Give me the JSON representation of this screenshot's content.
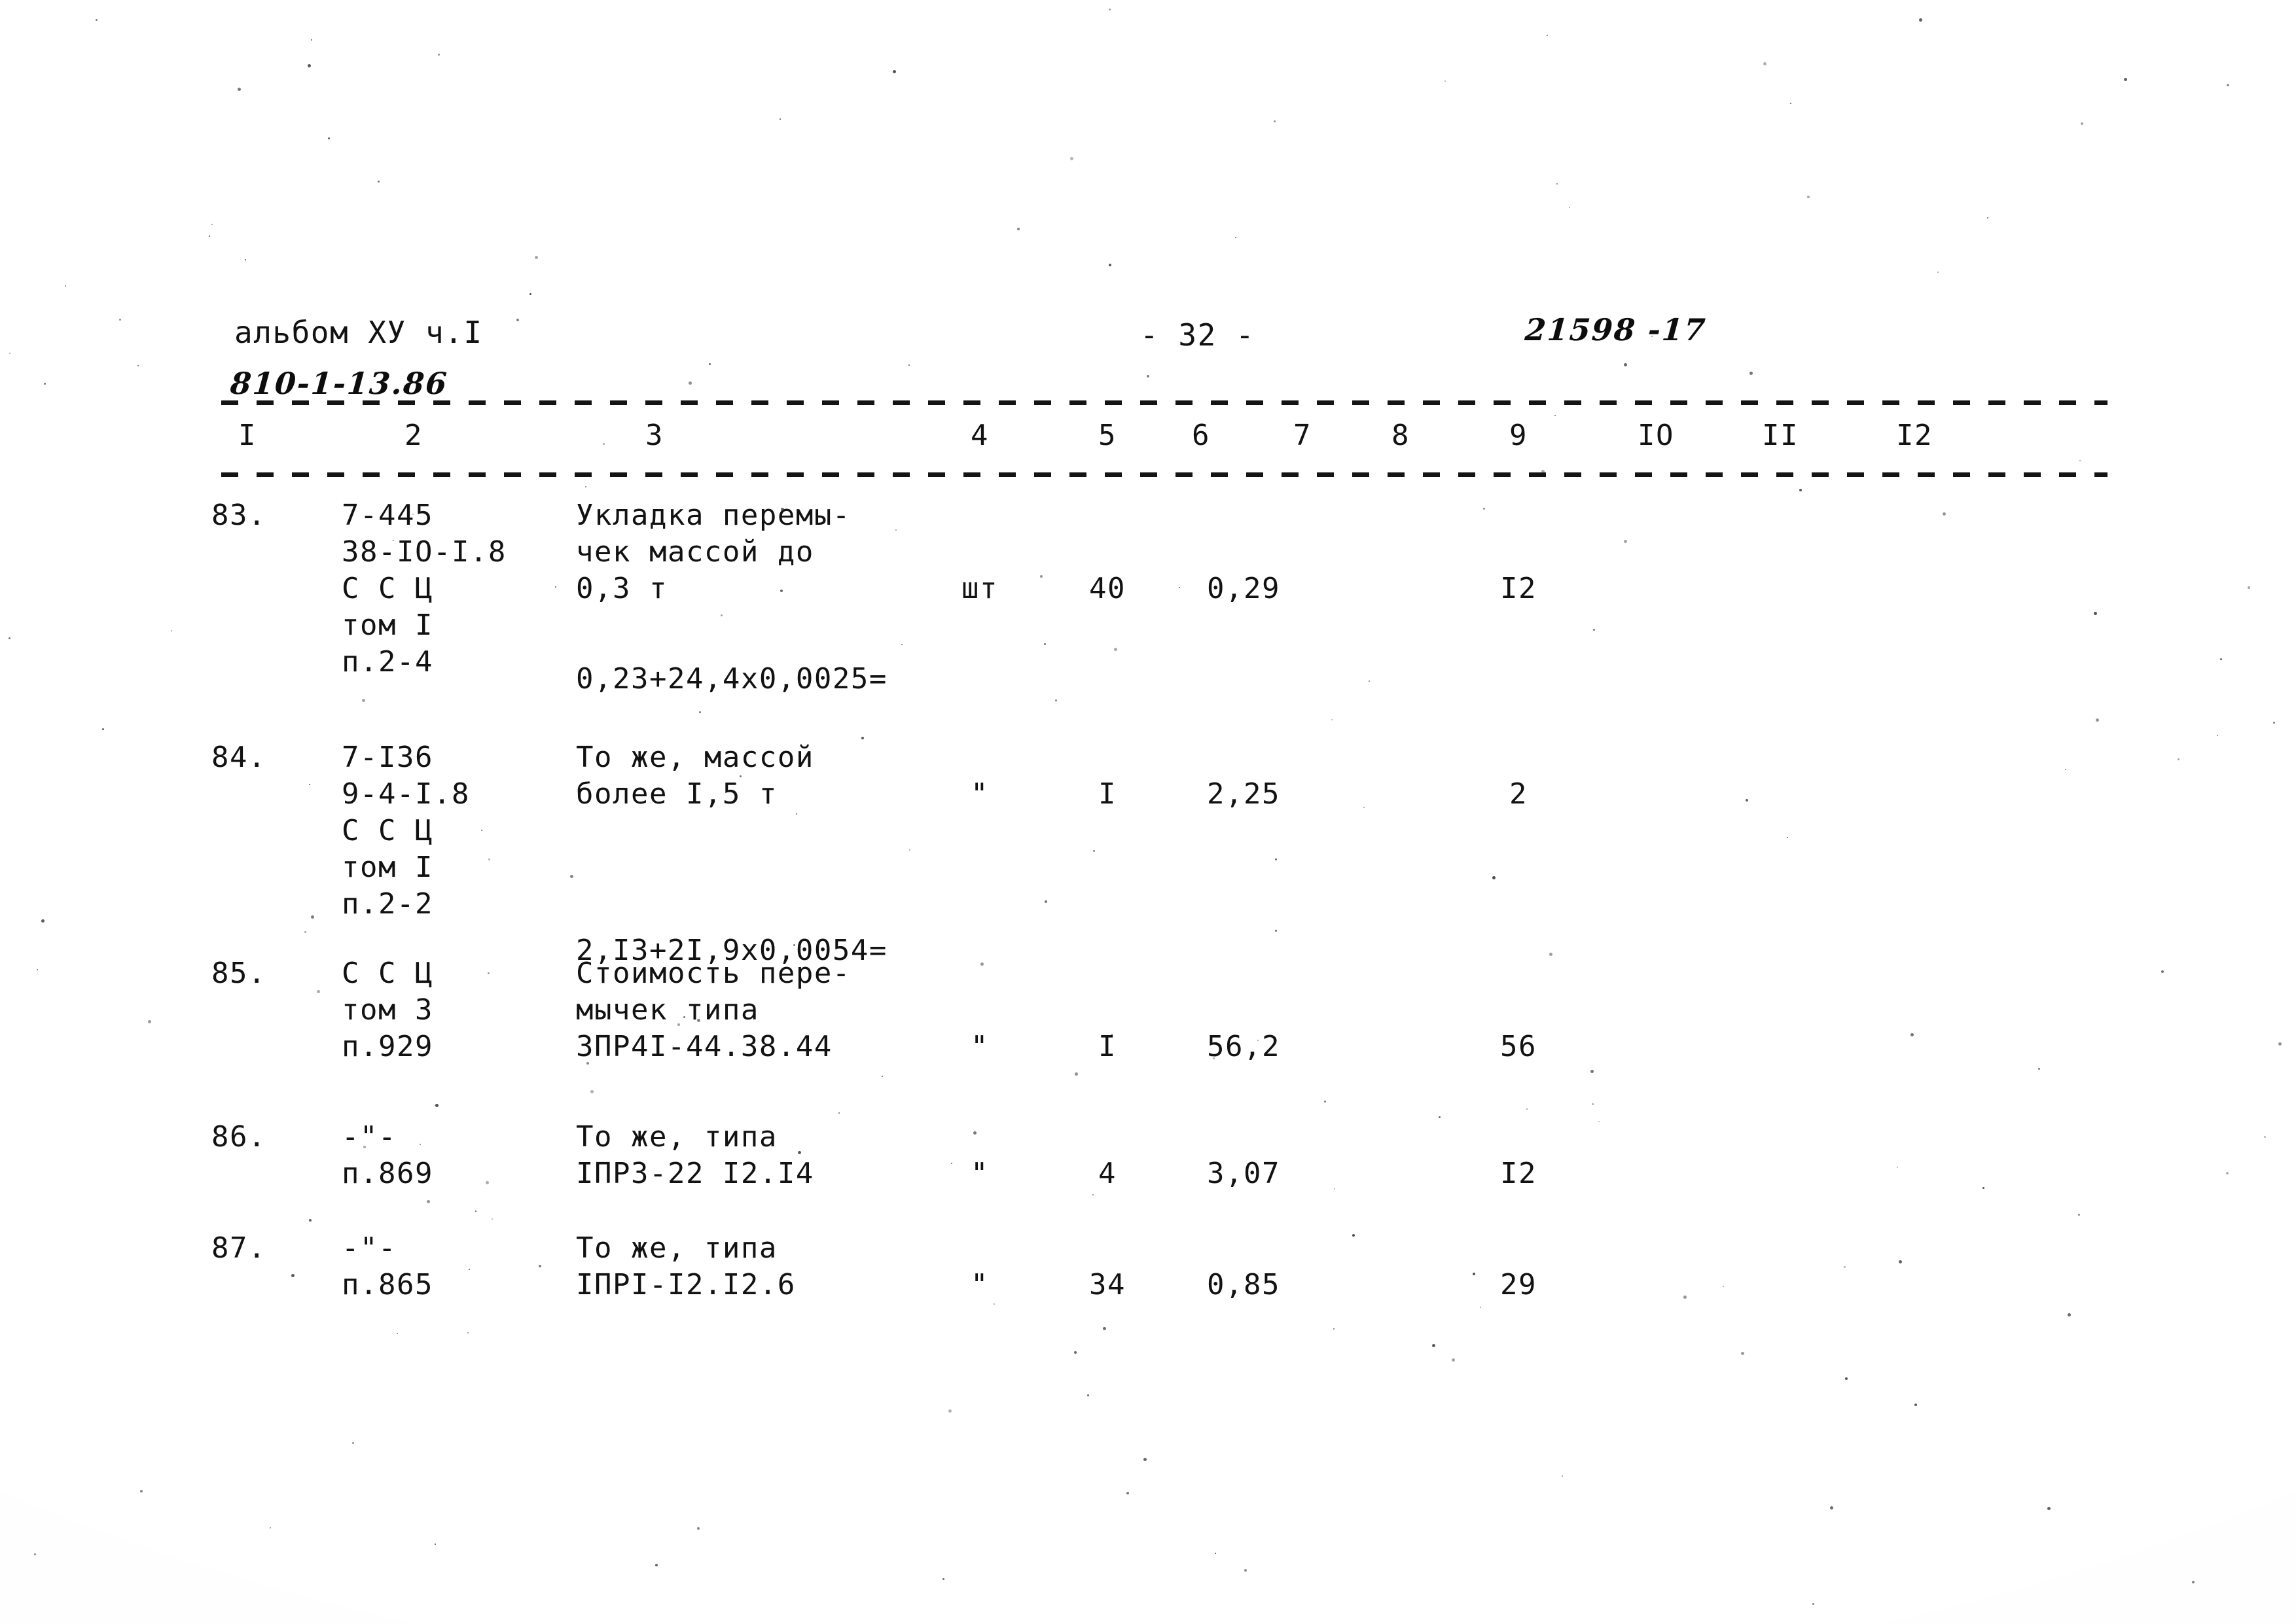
{
  "document": {
    "album_label": "альбом ХУ ч.I",
    "drawing_code": "810-1-13.86",
    "page_number": "- 32 -",
    "order_number": "21598 -17"
  },
  "table": {
    "column_headers": [
      "I",
      "2",
      "3",
      "4",
      "5",
      "6",
      "7",
      "8",
      "9",
      "IO",
      "II",
      "I2"
    ],
    "rows": [
      {
        "num": "83.",
        "code_lines": [
          "7-445",
          "38-IO-I.8",
          "С С Ц",
          "том I",
          "п.2-4"
        ],
        "description_lines": [
          "Укладка перемы-",
          "чек массой до",
          "0,3 т"
        ],
        "formula": "0,23+24,4х0,0025=",
        "unit": "шт",
        "qty": "40",
        "price": "0,29",
        "col7": "",
        "col8": "",
        "total": "I2",
        "col10": "",
        "col11": "",
        "col12": ""
      },
      {
        "num": "84.",
        "code_lines": [
          "7-I36",
          "9-4-I.8",
          "С С Ц",
          "том I",
          "п.2-2"
        ],
        "description_lines": [
          "То же, массой",
          "более I,5 т"
        ],
        "formula": "2,I3+2I,9х0,0054=",
        "unit": "\"",
        "qty": "I",
        "price": "2,25",
        "col7": "",
        "col8": "",
        "total": "2",
        "col10": "",
        "col11": "",
        "col12": ""
      },
      {
        "num": "85.",
        "code_lines": [
          "С С Ц",
          "том 3",
          "п.929"
        ],
        "description_lines": [
          "Стоимость пере-",
          "мычек типа",
          "3ПР4I-44.38.44"
        ],
        "formula": "",
        "unit": "\"",
        "qty": "I",
        "price": "56,2",
        "col7": "",
        "col8": "",
        "total": "56",
        "col10": "",
        "col11": "",
        "col12": ""
      },
      {
        "num": "86.",
        "code_lines": [
          "-\"-",
          "п.869"
        ],
        "description_lines": [
          "То же, типа",
          "IПР3-22 I2.I4"
        ],
        "formula": "",
        "unit": "\"",
        "qty": "4",
        "price": "3,07",
        "col7": "",
        "col8": "",
        "total": "I2",
        "col10": "",
        "col11": "",
        "col12": ""
      },
      {
        "num": "87.",
        "code_lines": [
          "-\"-",
          "п.865"
        ],
        "description_lines": [
          "То же, типа",
          "IПРI-I2.I2.6"
        ],
        "formula": "",
        "unit": "\"",
        "qty": "34",
        "price": "0,85",
        "col7": "",
        "col8": "",
        "total": "29",
        "col10": "",
        "col11": "",
        "col12": ""
      }
    ]
  }
}
